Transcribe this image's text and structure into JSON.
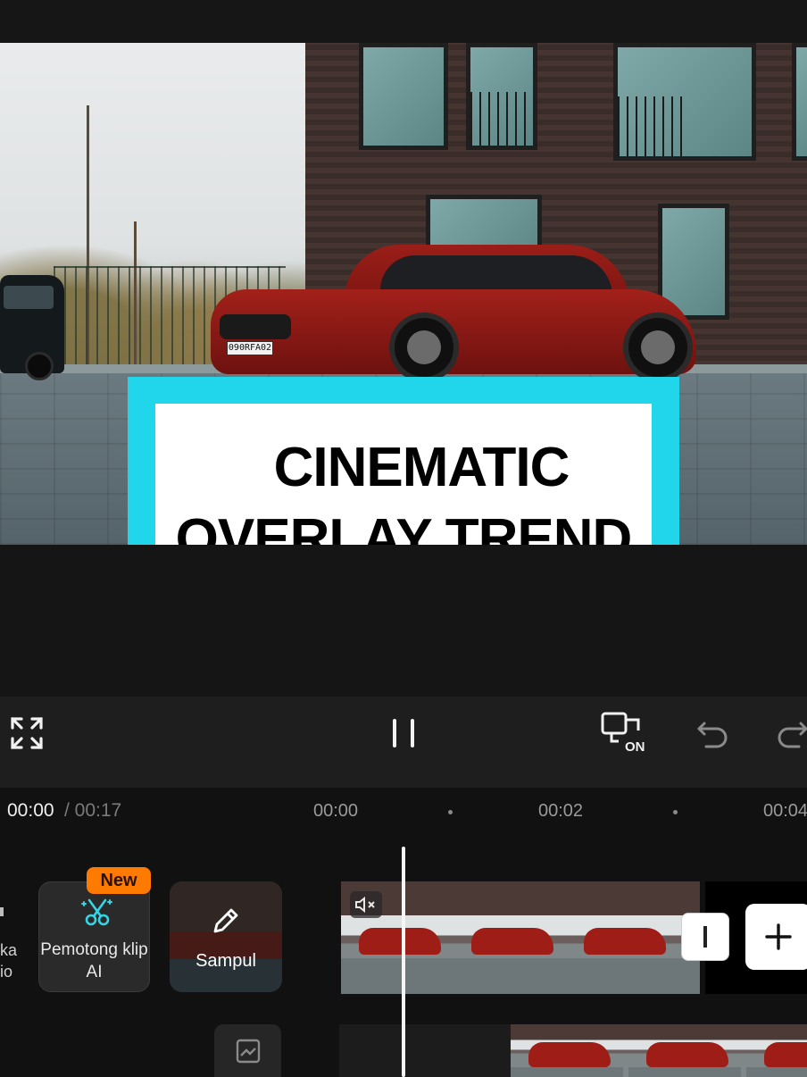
{
  "overlay_title": {
    "line1": "CINEMATIC",
    "line2": "OVERLAY TREND"
  },
  "colors": {
    "cyan": "#21d6ea",
    "pink": "#fe2c55",
    "navy": "#141625",
    "badge_orange": "#ff7a00"
  },
  "preview": {
    "plate": "090RFA02"
  },
  "toolbar": {
    "fullscreen_icon": "fullscreen-icon",
    "pause_icon": "pause-icon",
    "preview_toggle_icon": "preview-on-icon",
    "preview_toggle_label": "ON",
    "undo_icon": "undo-icon",
    "redo_icon": "redo-icon"
  },
  "timeline": {
    "current_time": "00:00",
    "total_time": "/ 00:17",
    "ruler_marks": [
      "00:00",
      "00:02",
      "00:04"
    ]
  },
  "side_tools": {
    "partial_label_line1": "ka",
    "partial_label_line2": "io",
    "ai_clip_cutter_label": "Pemotong klip AI",
    "new_badge": "New",
    "cover_label": "Sampul"
  }
}
